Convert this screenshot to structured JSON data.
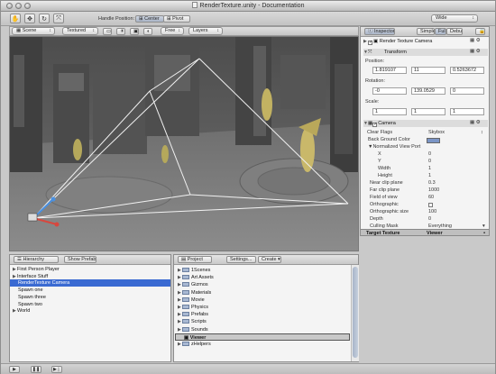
{
  "window": {
    "title": "RenderTexture.unity - Documentation"
  },
  "toolbar": {
    "handle_position_label": "Handle Position:",
    "center_label": "Center",
    "pivot_label": "Pivot",
    "layout_value": "Wide"
  },
  "scene": {
    "view_label": "Scene",
    "render_mode": "Textured",
    "camera_label": "Free",
    "layers_label": "Layers"
  },
  "inspector": {
    "tab_label": "Inspector",
    "simple_label": "Simple",
    "full_label": "Full",
    "debug_label": "Debug",
    "object_name": "Render Texture Camera",
    "transform_label": "Transform",
    "position_label": "Position:",
    "position": [
      "1.819107",
      "11",
      "0.5263672"
    ],
    "rotation_label": "Rotation:",
    "rotation": [
      "-0",
      "139.0529",
      "0"
    ],
    "scale_label": "Scale:",
    "scale": [
      "1",
      "1",
      "1"
    ],
    "camera_label": "Camera",
    "properties": [
      {
        "label": "Clear Flags",
        "value": "Skybox"
      },
      {
        "label": "Back Ground Color",
        "value": ""
      },
      {
        "label": "▼Normalized View Port",
        "value": ""
      },
      {
        "label": "X",
        "value": "0"
      },
      {
        "label": "Y",
        "value": "0"
      },
      {
        "label": "Width",
        "value": "1"
      },
      {
        "label": "Height",
        "value": "1"
      },
      {
        "label": "Near clip plane",
        "value": "0.3"
      },
      {
        "label": "Far clip plane",
        "value": "1000"
      },
      {
        "label": "Field of view",
        "value": "60"
      },
      {
        "label": "Orthographic",
        "value": ""
      },
      {
        "label": "Orthographic size",
        "value": "100"
      },
      {
        "label": "Depth",
        "value": "0"
      },
      {
        "label": "Culling Mask",
        "value": "Everything"
      }
    ],
    "target_texture_label": "Target Texture",
    "target_texture_value": "Viewer"
  },
  "hierarchy": {
    "tab_label": "Hierarchy",
    "show_prefab_label": "Show Prefab",
    "items": [
      {
        "label": "First Person Player"
      },
      {
        "label": "Interface Stuff"
      },
      {
        "label": "RenderTexture Camera"
      },
      {
        "label": "Spawn one"
      },
      {
        "label": "Spawn three"
      },
      {
        "label": "Spawn two"
      },
      {
        "label": "World"
      }
    ]
  },
  "project": {
    "tab_label": "Project",
    "settings_label": "Settings...",
    "create_label": "Create",
    "items": [
      {
        "label": "1Scenes"
      },
      {
        "label": "Art Assets"
      },
      {
        "label": "Gizmos"
      },
      {
        "label": "Materials"
      },
      {
        "label": "Movie"
      },
      {
        "label": "Physics"
      },
      {
        "label": "Prefabs"
      },
      {
        "label": "Scripts"
      },
      {
        "label": "Sounds"
      },
      {
        "label": "Viewer"
      },
      {
        "label": "zHelpers"
      }
    ]
  },
  "colors": {
    "selection": "#3a6ad2",
    "back_ground_color_swatch": "#7b95c6"
  }
}
